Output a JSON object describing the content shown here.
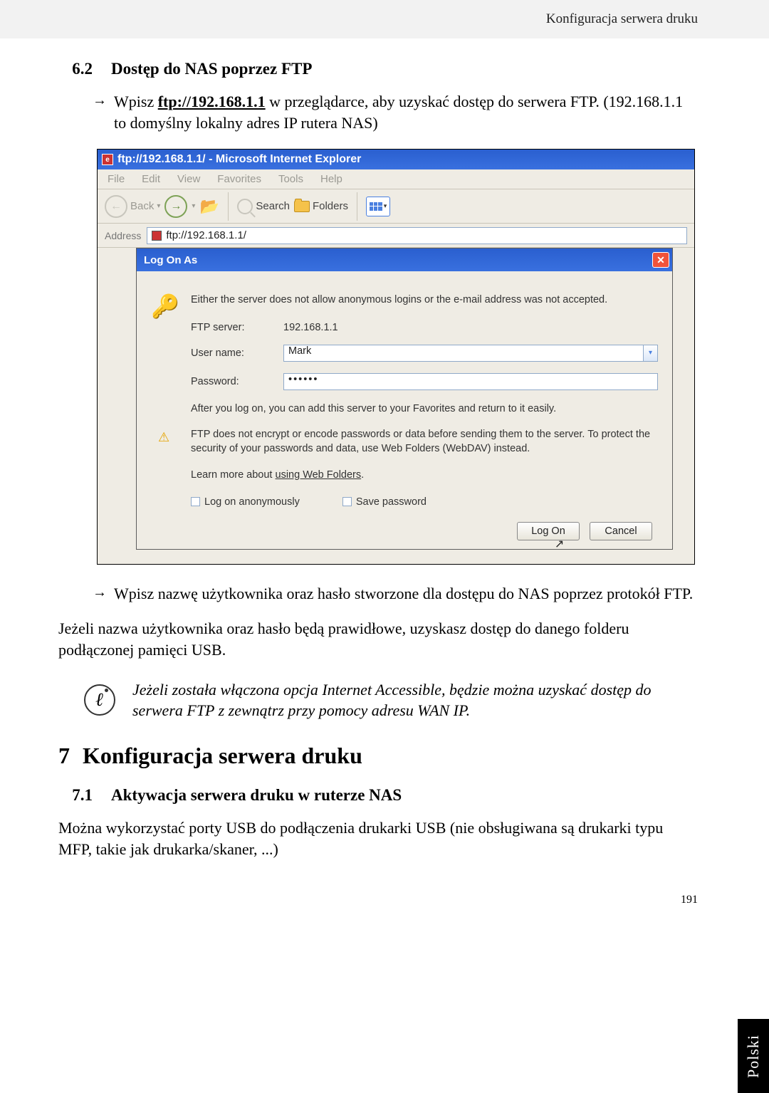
{
  "header": {
    "running_title": "Konfiguracja serwera druku"
  },
  "section62": {
    "num": "6.2",
    "title": "Dostęp do NAS poprzez FTP",
    "bullet1_prefix": "Wpisz ",
    "bullet1_link": "ftp://192.168.1.1",
    "bullet1_suffix": " w przeglądarce, aby uzyskać dostęp do serwera FTP. (192.168.1.1 to domyślny lokalny adres IP rutera NAS)"
  },
  "ie": {
    "title": "ftp://192.168.1.1/ - Microsoft Internet Explorer",
    "menu": {
      "file": "File",
      "edit": "Edit",
      "view": "View",
      "favorites": "Favorites",
      "tools": "Tools",
      "help": "Help"
    },
    "toolbar": {
      "back": "Back",
      "search": "Search",
      "folders": "Folders"
    },
    "address_label": "Address",
    "address_value": "ftp://192.168.1.1/"
  },
  "dialog": {
    "title": "Log On As",
    "message": "Either the server does not allow anonymous logins or the e-mail address was not accepted.",
    "ftp_server_label": "FTP server:",
    "ftp_server_value": "192.168.1.1",
    "username_label": "User name:",
    "username_value": "Mark",
    "password_label": "Password:",
    "password_value": "••••••",
    "after_note": "After you log on, you can add this server to your Favorites and return to it easily.",
    "warning": "FTP does not encrypt or encode passwords or data before sending them to the server.  To protect the security of your passwords and data, use Web Folders (WebDAV) instead.",
    "learn_prefix": "Learn more about ",
    "learn_link": "using Web Folders",
    "chk_anon": "Log on anonymously",
    "chk_save": "Save password",
    "btn_logon": "Log On",
    "btn_cancel": "Cancel"
  },
  "post": {
    "bullet2": "Wpisz nazwę użytkownika oraz hasło stworzone dla dostępu do NAS poprzez protokół FTP.",
    "para": "Jeżeli nazwa użytkownika oraz hasło będą prawidłowe, uzyskasz dostęp do danego folderu podłączonej pamięci USB.",
    "note": "Jeżeli została włączona opcja Internet Accessible, będzie można uzyskać dostęp do serwera FTP z zewnątrz przy pomocy adresu WAN IP."
  },
  "section7": {
    "num": "7",
    "title": "Konfiguracja serwera druku",
    "sub_num": "7.1",
    "sub_title": "Aktywacja serwera druku w ruterze NAS",
    "para": "Można wykorzystać porty USB do podłączenia drukarki USB (nie obsługiwana są drukarki typu MFP, takie jak drukarka/skaner, ...)"
  },
  "page_number": "191",
  "side_tab": "Polski"
}
